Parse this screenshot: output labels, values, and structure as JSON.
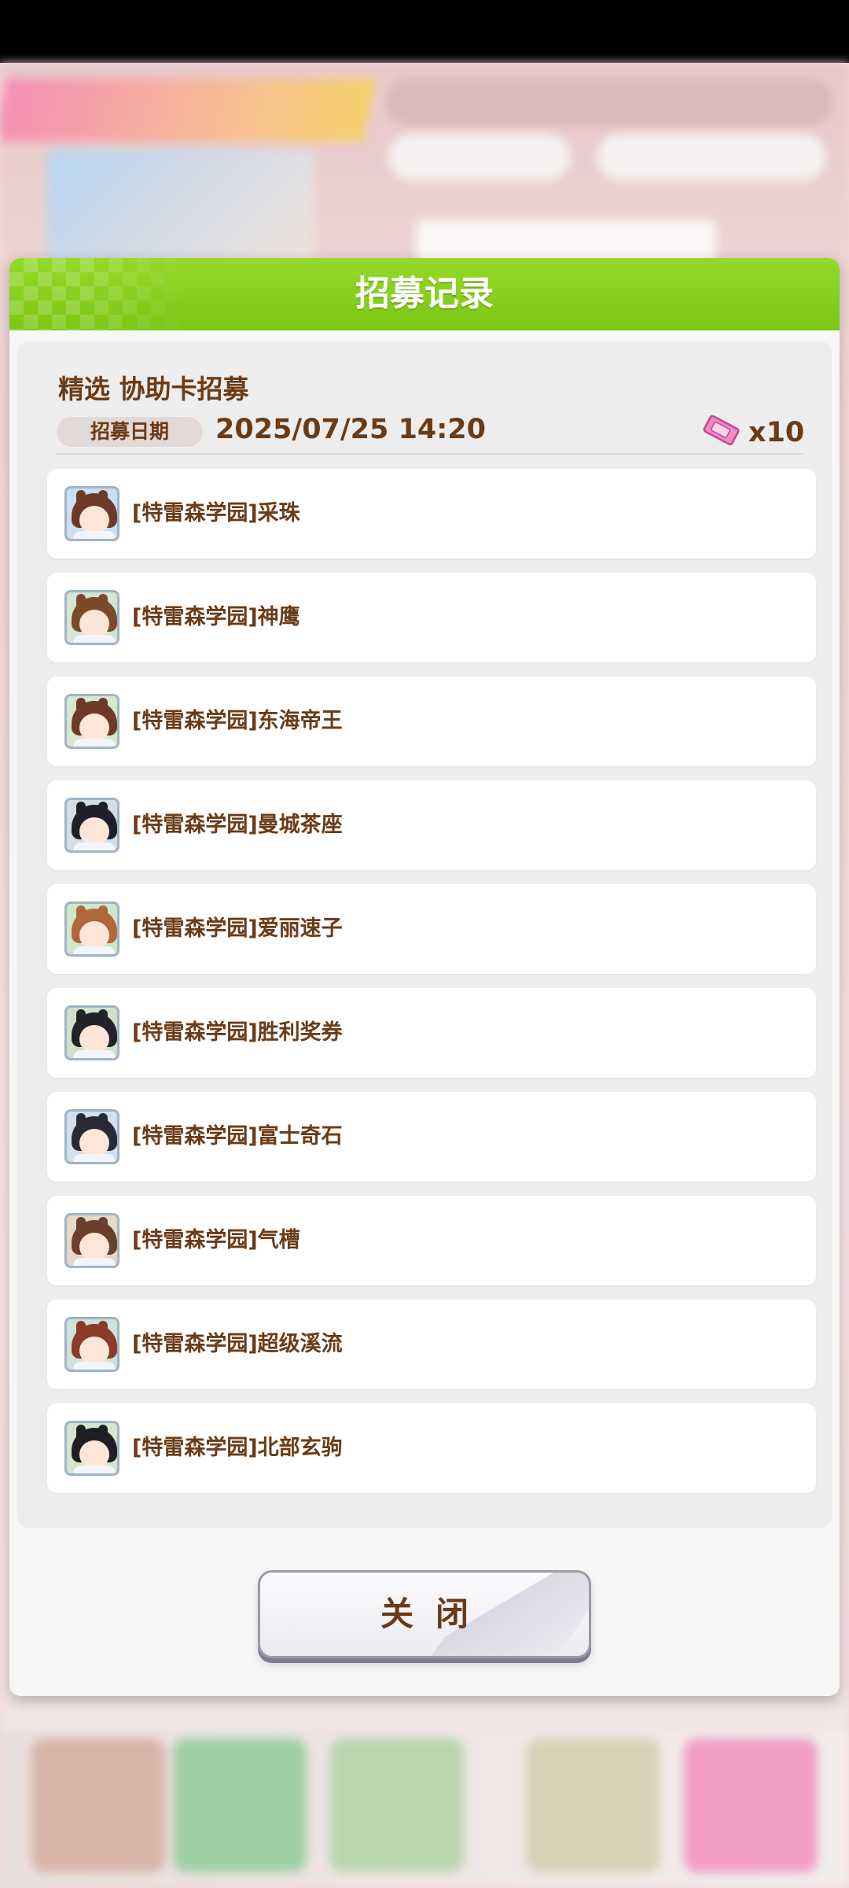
{
  "dialog": {
    "title": "招募记录",
    "gacha_name": "精选  协助卡招募",
    "date_label": "招募日期",
    "date_value": "2025/07/25  14:20",
    "ticket_icon": "ticket-icon",
    "ticket_count": "x10",
    "close_label": "关闭"
  },
  "results": [
    {
      "name": "[特雷森学园]采珠",
      "hair": "#6b3a2a",
      "bg": "#cbdff0"
    },
    {
      "name": "[特雷森学园]神鹰",
      "hair": "#7a4a2a",
      "bg": "#d6e4d2"
    },
    {
      "name": "[特雷森学园]东海帝王",
      "hair": "#6d3a28",
      "bg": "#d7e6cc"
    },
    {
      "name": "[特雷森学园]曼城茶座",
      "hair": "#1f1f2a",
      "bg": "#d3dde8"
    },
    {
      "name": "[特雷森学园]爱丽速子",
      "hair": "#b0683a",
      "bg": "#d0e6c8"
    },
    {
      "name": "[特雷森学园]胜利奖券",
      "hair": "#222228",
      "bg": "#d3e0c9"
    },
    {
      "name": "[特雷森学园]富士奇石",
      "hair": "#2a2a36",
      "bg": "#cfe0f0"
    },
    {
      "name": "[特雷森学园]气槽",
      "hair": "#6a3f2b",
      "bg": "#e6d8c6"
    },
    {
      "name": "[特雷森学园]超级溪流",
      "hair": "#8a3b2a",
      "bg": "#cfe2d9"
    },
    {
      "name": "[特雷森学园]北部玄驹",
      "hair": "#1e1e24",
      "bg": "#d3e5cc"
    }
  ]
}
